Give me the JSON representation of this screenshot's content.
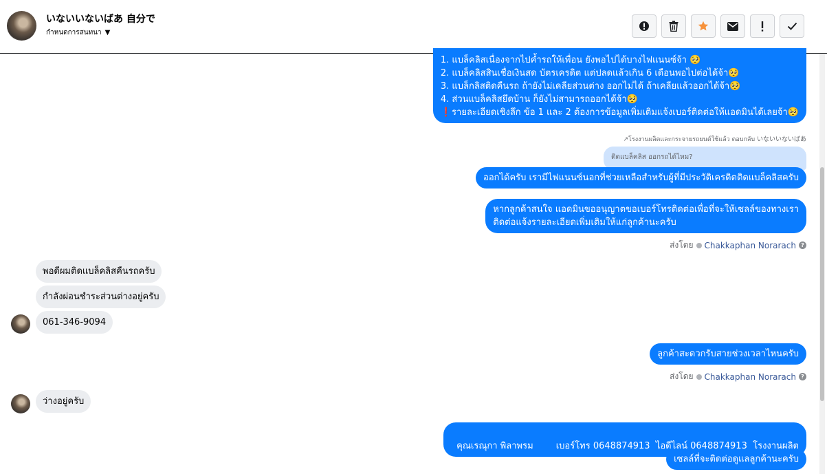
{
  "header": {
    "name": "いないいないばあ 自分で",
    "subtitle": "กำหนดการสนทนา",
    "caret": "▼"
  },
  "toolbar": {
    "buttons": [
      {
        "name": "spam-button",
        "icon": "alert-circle-icon"
      },
      {
        "name": "delete-button",
        "icon": "trash-icon"
      },
      {
        "name": "star-button",
        "icon": "star-icon",
        "color": "#f7923b"
      },
      {
        "name": "mark-unread-button",
        "icon": "envelope-icon"
      },
      {
        "name": "priority-button",
        "icon": "exclamation-icon"
      },
      {
        "name": "done-button",
        "icon": "check-icon"
      }
    ]
  },
  "colors": {
    "outgoing": "#0a7cff",
    "incoming": "#ebedf0",
    "agent": "#385898"
  },
  "messages": {
    "list_bubble": [
      "1. แบล็คลิสเนื่องจากไปค้ำรถให้เพื่อน ยังพอไปได้บางไฟแนนซ์จ้า 🥺",
      "2. แบล็คลิสสินเชื่อเงินสด บัตรเครดิต แต่ปลดแล้วเกิน 6 เดือนพอไปต่อได้จ้า🥺",
      "3. แบล็กลิสติดคืนรถ ถ้ายังไม่เคลียส่วนต่าง ออกไม่ได้ ถ้าเคลียแล้วออกได้จ้า🥺",
      "4. ส่วนแบล็คลิสยึดบ้าน ก็ยังไม่สามารถออกได้จ้า🥺",
      "❗รายละเอียดเชิงลึก ข้อ 1 และ 2 ต้องการข้อมูลเพิ่มเติมแจ้งเบอร์ติดต่อให้แอดมินได้เลยจ้า🥺"
    ],
    "reply_context": "↗โรงงานผลิตและกระจายรถยนต์ใช้แล้ว ตอบกลับ いないいないばあ",
    "reply_quote": "ติดแบล็คลิส ออกรถได้ไหม?",
    "out_1": "ออกได้ครับ เรามีไฟแนนซ์นอกที่ช่วยเหลือสำหรับผู้ที่มีประวัติเครดิตติดแบล็คลิสครับ",
    "out_2": [
      "หากลูกค้าสนใจ แอดมินขออนุญาตขอเบอร์โทรติดต่อเพื่อที่จะให้เซลล์ของทางเรา",
      "ติดต่อแจ้งรายละเอียดเพิ่มเติมให้แก่ลูกค้านะครับ"
    ],
    "sent_by_label": "ส่งโดย",
    "agent_name": "Chakkaphan Norarach",
    "in_1": "พอดีผมติดแบล็คลิสคืนรถครับ",
    "in_2": "กำลังผ่อนชำระส่วนต่างอยู่ครับ",
    "in_3": "061-346-9094",
    "out_3": "ลูกค้าสะดวกรับสายช่วงเวลาไหนครับ",
    "in_4": "ว่างอยู่ครับ",
    "out_4": "คุณเรณุกา พิลาพรม        เบอร์โทร 0648874913  ไอดีไลน์ 0648874913  โรงงานผลิต",
    "out_5": "เซลล์ที่จะติดต่อดูแลลูกค้านะครับ"
  }
}
